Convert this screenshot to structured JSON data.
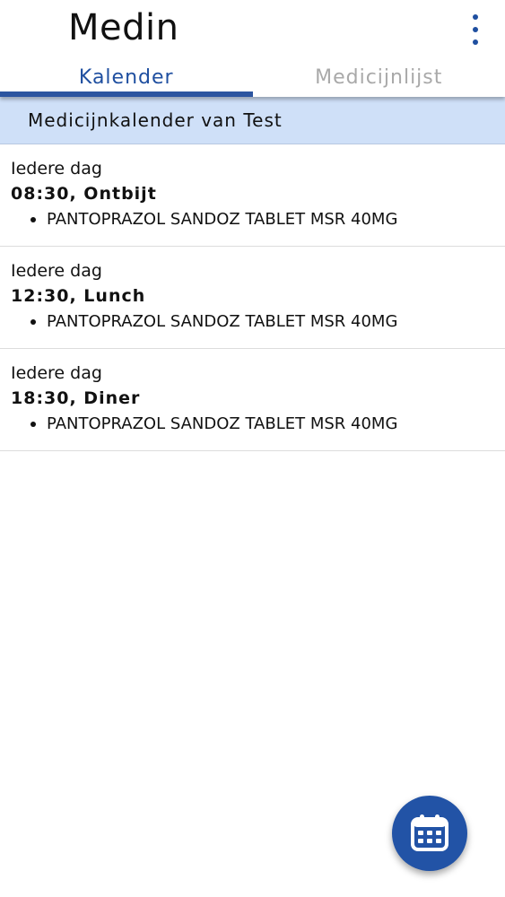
{
  "app": {
    "title": "Medin"
  },
  "tabs": [
    {
      "label": "Kalender",
      "active": true
    },
    {
      "label": "Medicijnlijst",
      "active": false
    }
  ],
  "section": {
    "title": "Medicijnkalender van Test"
  },
  "entries": [
    {
      "frequency": "Iedere dag",
      "time": "08:30, Ontbijt",
      "medication": "PANTOPRAZOL SANDOZ TABLET MSR 40MG"
    },
    {
      "frequency": "Iedere dag",
      "time": "12:30, Lunch",
      "medication": "PANTOPRAZOL SANDOZ TABLET MSR 40MG"
    },
    {
      "frequency": "Iedere dag",
      "time": "18:30, Diner",
      "medication": "PANTOPRAZOL SANDOZ TABLET MSR 40MG"
    }
  ],
  "icons": {
    "menu": "more-vertical-icon",
    "fab": "calendar-icon"
  },
  "colors": {
    "accent": "#1f4fa0",
    "header_bg": "#cfe0f8",
    "fab": "#2253a6",
    "inactive_tab": "#a9a9a9"
  }
}
